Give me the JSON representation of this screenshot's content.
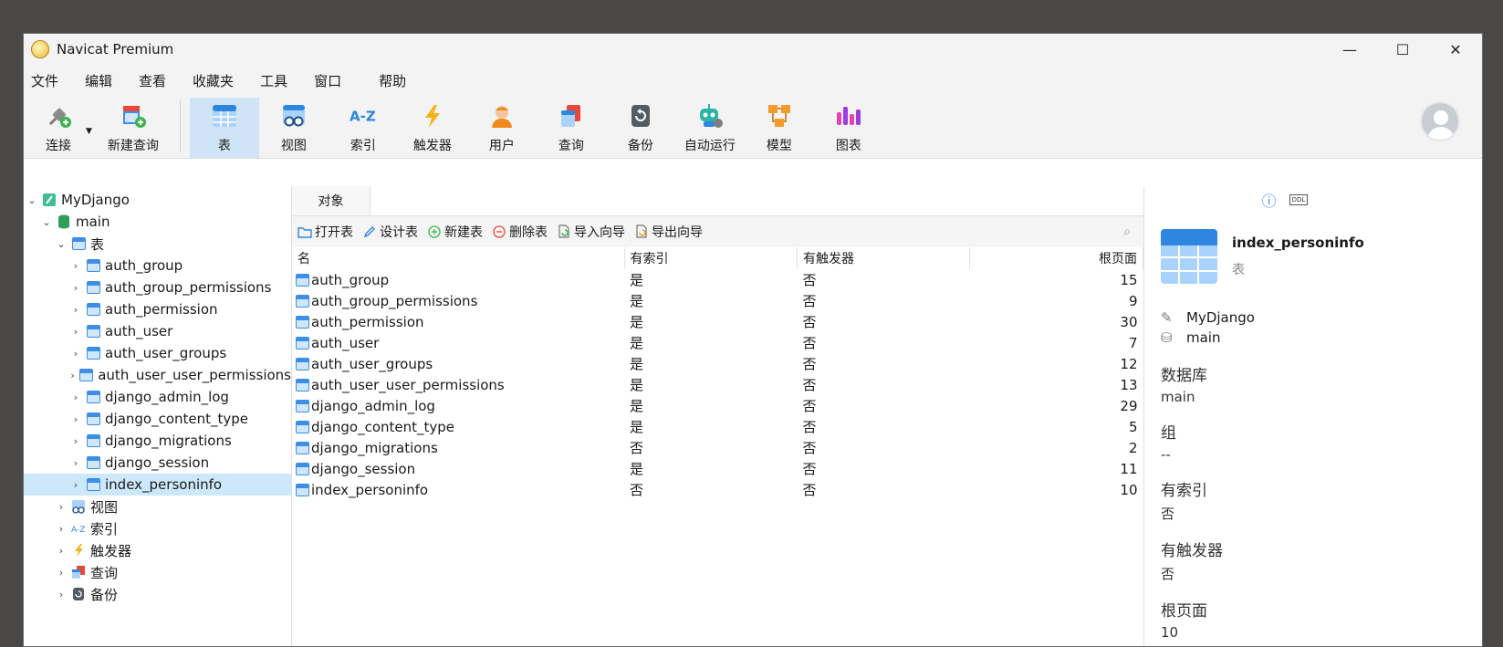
{
  "window": {
    "title": "Navicat Premium"
  },
  "controls": {
    "minimize": "—",
    "maximize": "☐",
    "close": "✕"
  },
  "menu": [
    "文件",
    "编辑",
    "查看",
    "收藏夹",
    "工具",
    "窗口",
    "帮助"
  ],
  "toolbar": {
    "connect": "连接",
    "new_query": "新建查询",
    "buttons": [
      {
        "label": "表",
        "icon": "table-icon",
        "active": true
      },
      {
        "label": "视图",
        "icon": "view-icon"
      },
      {
        "label": "索引",
        "icon": "index-icon"
      },
      {
        "label": "触发器",
        "icon": "trigger-icon"
      },
      {
        "label": "用户",
        "icon": "user-icon"
      },
      {
        "label": "查询",
        "icon": "query-icon"
      },
      {
        "label": "备份",
        "icon": "backup-icon"
      },
      {
        "label": "自动运行",
        "icon": "automation-icon"
      },
      {
        "label": "模型",
        "icon": "model-icon"
      },
      {
        "label": "图表",
        "icon": "chart-icon"
      }
    ]
  },
  "tree": {
    "connection": "MyDjango",
    "database": "main",
    "tables_group": "表",
    "tables": [
      "auth_group",
      "auth_group_permissions",
      "auth_permission",
      "auth_user",
      "auth_user_groups",
      "auth_user_user_permissions",
      "django_admin_log",
      "django_content_type",
      "django_migrations",
      "django_session",
      "index_personinfo"
    ],
    "selected": "index_personinfo",
    "other_groups": [
      {
        "label": "视图",
        "icon": "view-icon"
      },
      {
        "label": "索引",
        "icon": "index-icon"
      },
      {
        "label": "触发器",
        "icon": "trigger-icon"
      },
      {
        "label": "查询",
        "icon": "query-icon"
      },
      {
        "label": "备份",
        "icon": "backup-icon"
      }
    ]
  },
  "objects": {
    "tab": "对象",
    "actions": [
      {
        "label": "打开表",
        "icon": "open-folder-icon"
      },
      {
        "label": "设计表",
        "icon": "pencil-icon"
      },
      {
        "label": "新建表",
        "icon": "plus-circle-icon"
      },
      {
        "label": "删除表",
        "icon": "minus-circle-icon"
      },
      {
        "label": "导入向导",
        "icon": "import-icon"
      },
      {
        "label": "导出向导",
        "icon": "export-icon"
      }
    ],
    "columns": [
      "名",
      "有索引",
      "有触发器",
      "根页面"
    ],
    "rows": [
      [
        "auth_group",
        "是",
        "否",
        "15"
      ],
      [
        "auth_group_permissions",
        "是",
        "否",
        "9"
      ],
      [
        "auth_permission",
        "是",
        "否",
        "30"
      ],
      [
        "auth_user",
        "是",
        "否",
        "7"
      ],
      [
        "auth_user_groups",
        "是",
        "否",
        "12"
      ],
      [
        "auth_user_user_permissions",
        "是",
        "否",
        "13"
      ],
      [
        "django_admin_log",
        "是",
        "否",
        "29"
      ],
      [
        "django_content_type",
        "是",
        "否",
        "5"
      ],
      [
        "django_migrations",
        "否",
        "否",
        "2"
      ],
      [
        "django_session",
        "是",
        "否",
        "11"
      ],
      [
        "index_personinfo",
        "否",
        "否",
        "10"
      ]
    ]
  },
  "info": {
    "tab_info_icon": "ⓘ",
    "tab_ddl": "DDL",
    "name": "index_personinfo",
    "type": "表",
    "connection": "MyDjango",
    "database_name": "main",
    "props": [
      {
        "key": "数据库",
        "value": "main"
      },
      {
        "key": "组",
        "value": "--"
      },
      {
        "key": "有索引",
        "value": "否"
      },
      {
        "key": "有触发器",
        "value": "否"
      },
      {
        "key": "根页面",
        "value": "10"
      }
    ]
  }
}
